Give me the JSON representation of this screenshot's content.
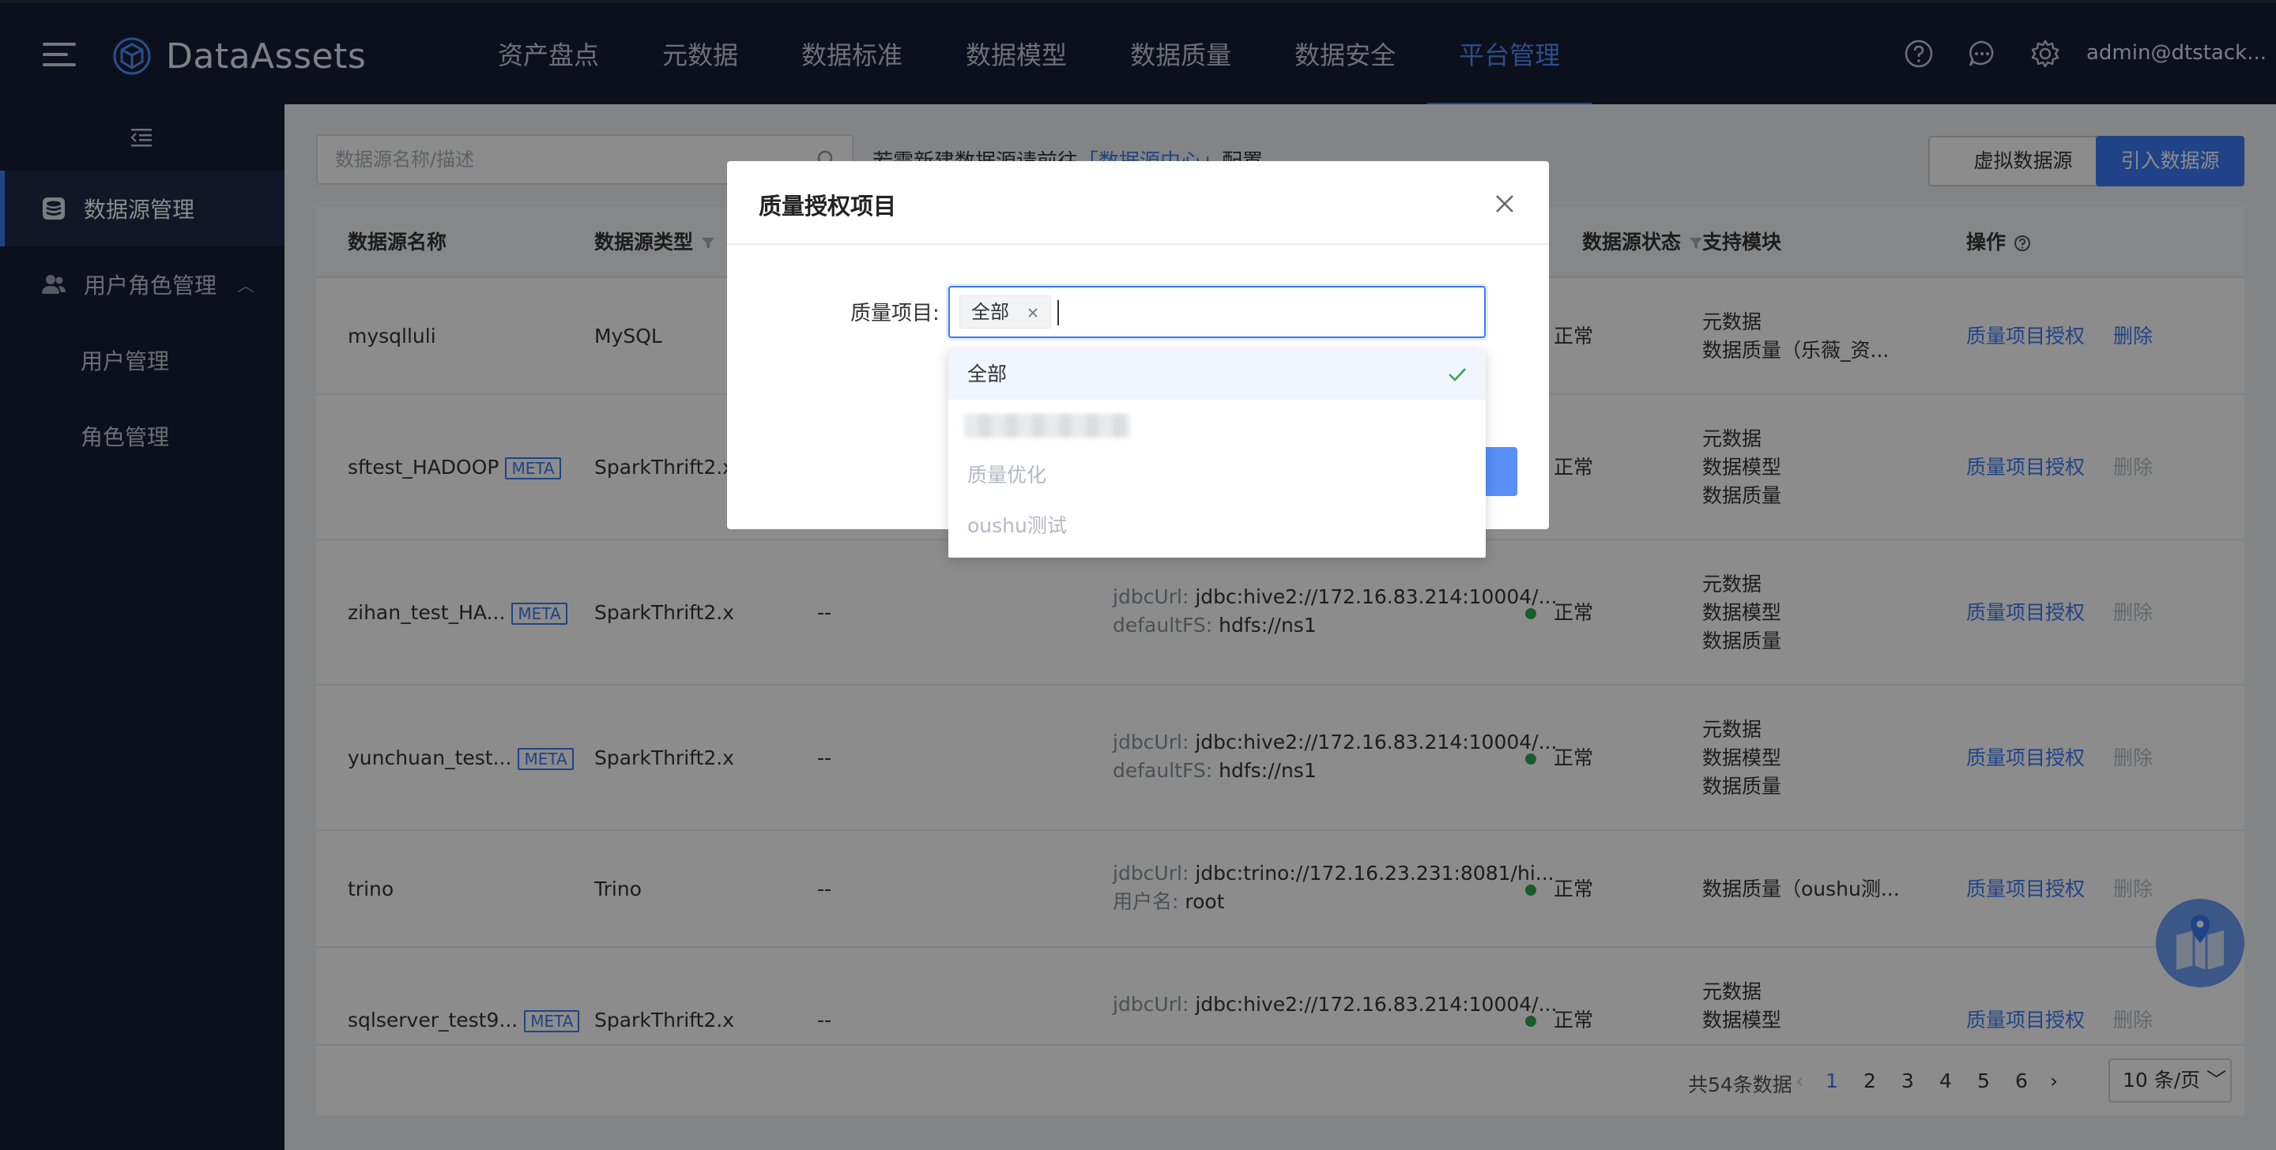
{
  "header": {
    "logo_text": "DataAssets",
    "nav": [
      "资产盘点",
      "元数据",
      "数据标准",
      "数据模型",
      "数据质量",
      "数据安全",
      "平台管理"
    ],
    "active_nav_index": 6,
    "user": "admin@dtstack...",
    "accent": "#3b7af6"
  },
  "sidebar": {
    "items": [
      {
        "label": "数据源管理",
        "icon": "datasource-icon"
      },
      {
        "label": "用户角色管理",
        "icon": "users-icon"
      }
    ],
    "subitems": [
      "用户管理",
      "角色管理"
    ]
  },
  "toolbar": {
    "search_placeholder": "数据源名称/描述",
    "hint_prefix": "若需新建数据源请前往",
    "hint_link": "「数据源中心」",
    "hint_suffix": "配置",
    "virtual_button": "虚拟数据源",
    "import_button": "引入数据源"
  },
  "table": {
    "columns": [
      "数据源名称",
      "数据源类型",
      "",
      "",
      "数据源状态",
      "支持模块",
      "操作"
    ],
    "rows": [
      {
        "name": "mysqlluli",
        "meta": "",
        "type": "MySQL",
        "desc": "",
        "conn1_label": "",
        "conn1": "",
        "conn2_label": "",
        "conn2": "",
        "status": "正常",
        "modules": [
          "元数据",
          "数据质量（乐薇_资..."
        ],
        "op": "质量项目授权",
        "del": "删除",
        "del_enabled": true
      },
      {
        "name": "sftest_HADOOP",
        "meta": "META",
        "type": "SparkThrift2.x",
        "desc": "",
        "conn1_label": "",
        "conn1": "",
        "conn2_label": "",
        "conn2": "",
        "status": "正常",
        "modules": [
          "元数据",
          "数据模型",
          "数据质量"
        ],
        "op": "质量项目授权",
        "del": "删除",
        "del_enabled": false
      },
      {
        "name": "zihan_test_HA...",
        "meta": "META",
        "type": "SparkThrift2.x",
        "desc": "--",
        "conn1_label": "jdbcUrl:",
        "conn1": "jdbc:hive2://172.16.83.214:10004/...",
        "conn2_label": "defaultFS:",
        "conn2": "hdfs://ns1",
        "status": "正常",
        "modules": [
          "元数据",
          "数据模型",
          "数据质量"
        ],
        "op": "质量项目授权",
        "del": "删除",
        "del_enabled": false
      },
      {
        "name": "yunchuan_test...",
        "meta": "META",
        "type": "SparkThrift2.x",
        "desc": "--",
        "conn1_label": "jdbcUrl:",
        "conn1": "jdbc:hive2://172.16.83.214:10004/...",
        "conn2_label": "defaultFS:",
        "conn2": "hdfs://ns1",
        "status": "正常",
        "modules": [
          "元数据",
          "数据模型",
          "数据质量"
        ],
        "op": "质量项目授权",
        "del": "删除",
        "del_enabled": false
      },
      {
        "name": "trino",
        "meta": "",
        "type": "Trino",
        "desc": "--",
        "conn1_label": "jdbcUrl:",
        "conn1": "jdbc:trino://172.16.23.231:8081/hi...",
        "conn2_label": "用户名:",
        "conn2": "root",
        "status": "正常",
        "modules": [
          "数据质量（oushu测..."
        ],
        "op": "质量项目授权",
        "del": "删除",
        "del_enabled": false
      },
      {
        "name": "sqlserver_test9...",
        "meta": "META",
        "type": "SparkThrift2.x",
        "desc": "--",
        "conn1_label": "jdbcUrl:",
        "conn1": "jdbc:hive2://172.16.83.214:10004/...",
        "conn2_label": "",
        "conn2": "",
        "status": "正常",
        "modules": [
          "元数据",
          "数据模型"
        ],
        "op": "质量项目授权",
        "del": "删除",
        "del_enabled": false
      }
    ]
  },
  "pagination": {
    "total": "共54条数据",
    "pages": [
      "1",
      "2",
      "3",
      "4",
      "5",
      "6"
    ],
    "current": "1",
    "page_size": "10 条/页"
  },
  "modal": {
    "title": "质量授权项目",
    "field_label": "质量项目:",
    "selected_tag": "全部",
    "options": [
      {
        "label": "全部",
        "selected": true,
        "disabled": false,
        "blurred": false
      },
      {
        "label": "",
        "selected": false,
        "disabled": false,
        "blurred": true
      },
      {
        "label": "质量优化",
        "selected": false,
        "disabled": true,
        "blurred": false
      },
      {
        "label": "oushu测试",
        "selected": false,
        "disabled": true,
        "blurred": false
      }
    ]
  }
}
